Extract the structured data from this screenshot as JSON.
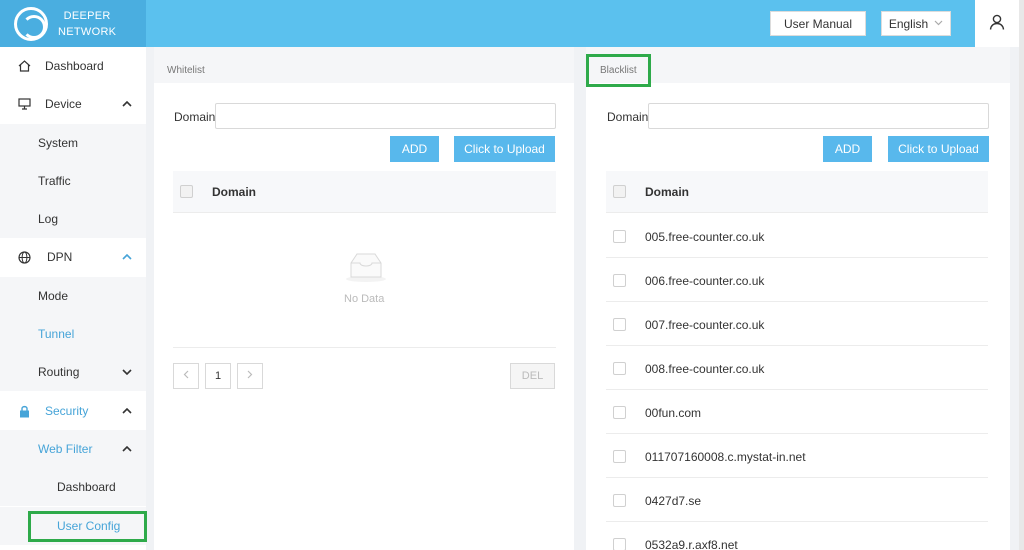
{
  "header": {
    "brand_line1": "DEEPER",
    "brand_line2": "NETWORK",
    "user_manual_label": "User Manual",
    "language_label": "English"
  },
  "sidebar": {
    "dashboard": "Dashboard",
    "device": "Device",
    "system": "System",
    "traffic": "Traffic",
    "log": "Log",
    "dpn": "DPN",
    "mode": "Mode",
    "tunnel": "Tunnel",
    "routing": "Routing",
    "security": "Security",
    "web_filter": "Web Filter",
    "wf_dashboard": "Dashboard",
    "user_config": "User Config"
  },
  "colors": {
    "header": "#5bc1ee",
    "accent": "#46a4d8",
    "highlight": "#2eaa4a",
    "button": "#58b8ec"
  },
  "whitelist": {
    "title": "Whitelist",
    "domain_label": "Domain:",
    "add_label": "ADD",
    "upload_label": "Click to Upload",
    "column_domain": "Domain",
    "empty_text": "No Data",
    "page_number": "1",
    "del_label": "DEL"
  },
  "blacklist": {
    "title": "Blacklist",
    "domain_label": "Domain:",
    "add_label": "ADD",
    "upload_label": "Click to Upload",
    "column_domain": "Domain",
    "rows": [
      "005.free-counter.co.uk",
      "006.free-counter.co.uk",
      "007.free-counter.co.uk",
      "008.free-counter.co.uk",
      "00fun.com",
      "011707160008.c.mystat-in.net",
      "0427d7.se",
      "0532a9.r.axf8.net"
    ]
  }
}
